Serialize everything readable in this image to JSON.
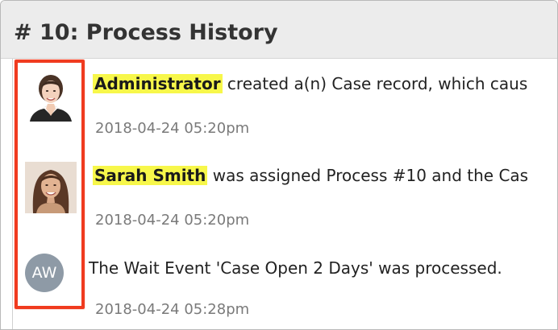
{
  "panel": {
    "title": "# 10: Process History"
  },
  "entries": [
    {
      "actor": "Administrator",
      "message": " created a(n)  Case record, which caus",
      "timestamp": "2018-04-24 05:20pm",
      "avatar": "portrait-photo"
    },
    {
      "actor": "Sarah Smith",
      "message": " was assigned Process #10 and the  Cas",
      "timestamp": "2018-04-24 05:20pm",
      "avatar": "portrait-photo"
    },
    {
      "actor": "",
      "message": "The Wait Event 'Case Open 2 Days' was processed.",
      "timestamp": "2018-04-24 05:28pm",
      "avatar": "initials",
      "initials": "AW"
    }
  ],
  "colors": {
    "highlight_border": "#f03b1f",
    "actor_highlight": "#f7f74a",
    "header_bg": "#ececec",
    "initials_avatar_bg": "#8e9aa6"
  }
}
